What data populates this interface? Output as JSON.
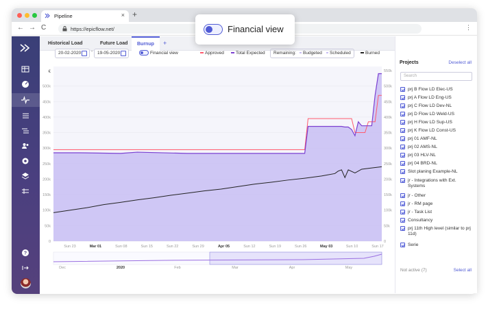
{
  "browser": {
    "tab_title": "Pipeline",
    "tab_close": "×",
    "new_tab": "+",
    "url": "https://epicflow.net/",
    "nav_back": "←",
    "nav_forward": "→",
    "nav_reload": "C",
    "menu": "⋮"
  },
  "callout": {
    "label": "Financial view"
  },
  "views": {
    "tabs": [
      "Historical Load",
      "Future Load",
      "Burnup"
    ],
    "active": "Burnup",
    "add": "+"
  },
  "filters": {
    "date_from": "20-02-2020",
    "date_to": "19-05-2020",
    "date_sep": "-",
    "financial_view": "Financial view",
    "legend_approved": "Approved",
    "legend_total_expected": "Total Expected",
    "remaining_label": "Remaining:",
    "legend_budgeted": "Budgeted",
    "legend_scheduled": "Scheduled",
    "legend_burned": "Burned"
  },
  "colors": {
    "accent": "#4f5ad4",
    "approved": "#ff5a6e",
    "total_expected": "#7b3fd1",
    "fill": "#c8bef3",
    "burned": "#222222"
  },
  "chart_data": {
    "type": "line",
    "y_unit": "€",
    "ylim": [
      0,
      550000
    ],
    "y_ticks": [
      "0",
      "50k",
      "100k",
      "150k",
      "200k",
      "250k",
      "300k",
      "350k",
      "400k",
      "450k",
      "500k"
    ],
    "y_ticks_right": [
      "0",
      "50k",
      "100k",
      "150k",
      "200k",
      "250k",
      "300k",
      "350k",
      "400k",
      "450k",
      "500k",
      "550k"
    ],
    "x_ticks": [
      "Sun 23",
      "Mar 01",
      "Sun 08",
      "Sun 15",
      "Sun 22",
      "Sun 29",
      "Apr 05",
      "Sun 12",
      "Sun 19",
      "Sun 26",
      "May 03",
      "Sun 10",
      "Sun 17"
    ],
    "x_ticks_bold": [
      "Mar 01",
      "Apr 05",
      "May 03"
    ],
    "series": [
      {
        "name": "Approved",
        "x": [
          0,
          40,
          41,
          75,
          76,
          87,
          88,
          89,
          90,
          93,
          94,
          96,
          97,
          98
        ],
        "values": [
          295000,
          295000,
          295000,
          295000,
          395000,
          395000,
          395000,
          395000,
          350000,
          350000,
          385000,
          385000,
          470000,
          470000
        ]
      },
      {
        "name": "Total Expected",
        "x": [
          0,
          8,
          20,
          25,
          40,
          55,
          75,
          76,
          86,
          87,
          88,
          89,
          90,
          91,
          92,
          95,
          96,
          97,
          98
        ],
        "values": [
          285000,
          285000,
          283000,
          287000,
          283000,
          283000,
          283000,
          370000,
          370000,
          368000,
          368000,
          360000,
          340000,
          385000,
          372000,
          372000,
          470000,
          540000,
          540000
        ]
      },
      {
        "name": "Burned",
        "x": [
          0,
          5,
          10,
          15,
          20,
          25,
          30,
          35,
          40,
          45,
          50,
          55,
          60,
          65,
          70,
          75,
          80,
          84,
          85,
          86,
          87,
          88,
          90,
          92,
          95,
          98
        ],
        "values": [
          92000,
          100000,
          108000,
          118000,
          125000,
          133000,
          140000,
          148000,
          155000,
          162000,
          168000,
          176000,
          184000,
          190000,
          197000,
          203000,
          210000,
          218000,
          226000,
          230000,
          205000,
          230000,
          220000,
          232000,
          236000,
          240000
        ]
      }
    ],
    "navigator_labels": [
      "Dec",
      "2020",
      "Feb",
      "Mar",
      "Apr",
      "May"
    ]
  },
  "projects": {
    "title": "Projects",
    "deselect_all": "Deselect all",
    "search_placeholder": "Search",
    "items": [
      "prj B Flow LD Elec-US",
      "prj A Flow LD Eng-US",
      "prj C Flow LD Dev-NL",
      "prj D Flow LD Weld-US",
      "prj H Flow LD Sup-US",
      "prj K Flow LD Const-US",
      "prj 01 AMF-NL",
      "prj 02 AMS-NL",
      "prj 03 HLV-NL",
      "prj 04 BRD-NL",
      "Slot planing Example-NL",
      "jr - Integrations with Ext. Systems",
      "jr - Other",
      "jr - RM page",
      "jr - Task List",
      "Consultancy",
      "prj 11th High level (similar to prj 11d)",
      "Serie"
    ],
    "not_active": "Not active (7)",
    "select_all": "Select all"
  }
}
